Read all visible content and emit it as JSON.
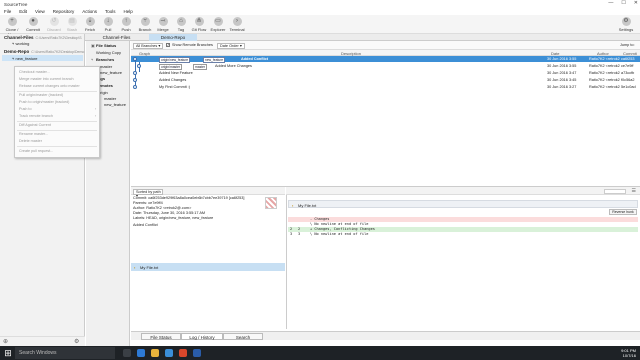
{
  "window": {
    "title": "SourceTree",
    "controls": [
      "—",
      "☐",
      "✕"
    ]
  },
  "menu": [
    "File",
    "Edit",
    "View",
    "Repository",
    "Actions",
    "Tools",
    "Help"
  ],
  "toolbar": {
    "buttons": [
      {
        "label": "Clone / New",
        "icon": "clone-icon",
        "enabled": true
      },
      {
        "label": "Commit",
        "icon": "commit-icon",
        "enabled": true
      },
      {
        "label": "Discard",
        "icon": "discard-icon",
        "enabled": false
      },
      {
        "label": "Stash",
        "icon": "stash-icon",
        "enabled": false
      },
      {
        "label": "Fetch",
        "icon": "fetch-icon",
        "enabled": true
      },
      {
        "label": "Pull",
        "icon": "pull-icon",
        "enabled": true
      },
      {
        "label": "Push",
        "icon": "push-icon",
        "enabled": true
      },
      {
        "label": "Branch",
        "icon": "branch-icon",
        "enabled": true
      },
      {
        "label": "Merge",
        "icon": "merge-icon",
        "enabled": true
      },
      {
        "label": "Tag",
        "icon": "tag-icon",
        "enabled": true
      },
      {
        "label": "Git Flow",
        "icon": "git-flow-icon",
        "enabled": true
      },
      {
        "label": "Explorer",
        "icon": "explorer-icon",
        "enabled": true
      },
      {
        "label": "Terminal",
        "icon": "terminal-icon",
        "enabled": true
      }
    ],
    "settings_label": "Settings"
  },
  "repos": [
    {
      "name": "Channel-Files",
      "path": "C:\\Users\\Ratio7K2\\Desktop\\S",
      "branch": "working"
    },
    {
      "name": "Demo-Repo",
      "path": "C:\\Users\\Ratio7K2\\Desktop\\Demo",
      "branch": "new_feature"
    }
  ],
  "context_menu": [
    "Checkout master...",
    "Merge master into current branch",
    "Rebase current changes onto master",
    "Pull origin/master (tracked)",
    "Push to origin/master (tracked)",
    "Push to",
    "Track remote branch",
    "Diff Against Current",
    "Rename master...",
    "Delete master",
    "Create pull request..."
  ],
  "tabs": [
    {
      "label": "Channel-Files",
      "active": false
    },
    {
      "label": "Demo-Repo",
      "active": true
    }
  ],
  "nav": {
    "file_status": "File Status",
    "working_copy": "Working Copy",
    "branches": "Branches",
    "branch_items": [
      "master",
      "new_feature"
    ],
    "tags": "Tags",
    "remotes": "Remotes",
    "remote_items": [
      "origin"
    ],
    "remote_branch_items": [
      "master",
      "new_feature"
    ]
  },
  "filter": {
    "branch_select": "All Branches",
    "show_remote": "Show Remote Branches",
    "order_select": "Date Order",
    "jump_to": "Jump to:"
  },
  "columns": [
    "Graph",
    "Description",
    "Date",
    "Author",
    "Commit"
  ],
  "commits": [
    {
      "labels": [
        "origin/new_feature",
        "new_feature"
      ],
      "description": "Added Conflict",
      "date": "30 Jun 2016 3:55",
      "author": "Ratio7K2 <retrok2",
      "commit": "ca6f253",
      "selected": true
    },
    {
      "labels": [
        "origin/master",
        "master"
      ],
      "description": "Added More Changes",
      "date": "30 Jun 2016 3:55",
      "author": "Ratio7K2 <retrok2",
      "commit": "ce7e9ff",
      "selected": false
    },
    {
      "labels": [],
      "description": "Added New Feature",
      "date": "30 Jun 2016 3:47",
      "author": "Ratio7K2 <retrok2",
      "commit": "a73ccfb",
      "selected": false
    },
    {
      "labels": [],
      "description": "Added Changes",
      "date": "30 Jun 2016 3:45",
      "author": "Ratio7K2 <retrok2",
      "commit": "f0c56a2",
      "selected": false
    },
    {
      "labels": [],
      "description": "My First Commit :)",
      "date": "30 Jun 2016 3:27",
      "author": "Ratio7K2 <retrok2",
      "commit": "5e1c0ad",
      "selected": false
    }
  ],
  "files_sort": "Sorted by path",
  "details": {
    "commit": "Commit: ca6f253de929f63a8a0cea0eb6b7cbb7ee39719 [ca6f253]",
    "parents": "Parents: ce7e9ff4",
    "author": "Author: Ratio7K2 <retrok2@.com>",
    "date": "Date: Thursday, June 30, 2016 3:55:17 AM",
    "labels": "Labels: HEAD, origin/new_feature, new_feature",
    "message": "Added Conflict"
  },
  "changed_file": "My File.txt",
  "diff": {
    "file": "My File.txt",
    "hunk_button": "Reverse hunk",
    "lines": [
      {
        "type": "del",
        "old": "",
        "new": "",
        "text": "- Changes"
      },
      {
        "type": "ctx",
        "old": "",
        "new": "",
        "text": "  \\ No newline at end of file"
      },
      {
        "type": "add",
        "old": "2",
        "new": "2",
        "text": "+ Changes, Conflicting Changes"
      },
      {
        "type": "ctx",
        "old": "3",
        "new": "3",
        "text": "  \\ No newline at end of file"
      }
    ]
  },
  "bottom_tabs": [
    {
      "label": "File Status",
      "active": false
    },
    {
      "label": "Log / History",
      "active": true
    },
    {
      "label": "Search",
      "active": false
    }
  ],
  "taskbar": {
    "search_placeholder": "Search Windows",
    "time": "9:01 PM",
    "date": "10/7/16"
  }
}
